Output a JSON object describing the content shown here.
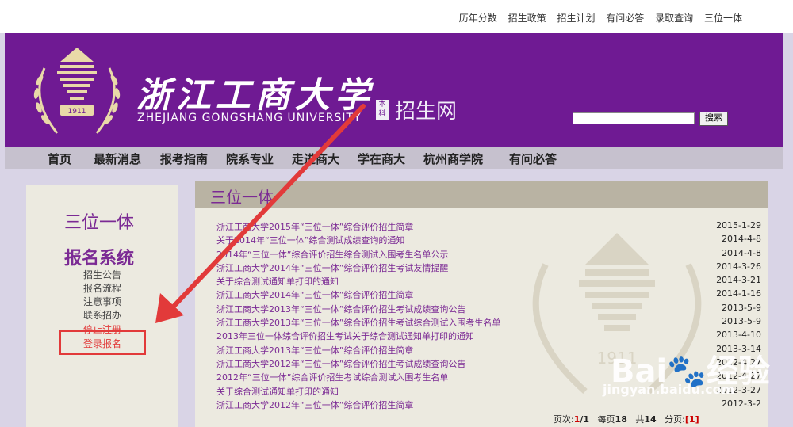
{
  "top_links": [
    "历年分数",
    "招生政策",
    "招生计划",
    "有问必答",
    "录取查询",
    "三位一体"
  ],
  "banner": {
    "emblem_year": "1911",
    "logo_cn": "浙江工商大学",
    "logo_en": "ZHEJIANG GONGSHANG UNIVERSITY",
    "benke": "本科",
    "zsw": "招生网",
    "search_button": "搜索",
    "search_value": ""
  },
  "nav": [
    "首页",
    "最新消息",
    "报考指南",
    "院系专业",
    "走进商大",
    "学在商大",
    "杭州商学院",
    "有问必答"
  ],
  "sidebar": {
    "title1": "三位一体",
    "title2": "报名系统",
    "items": [
      "招生公告",
      "报名流程",
      "注意事项",
      "联系招办",
      "停止注册",
      "登录报名"
    ]
  },
  "content": {
    "title": "三位一体",
    "news": [
      {
        "title": "浙江工商大学2015年“三位一体”综合评价招生简章",
        "date": "2015-1-29"
      },
      {
        "title": "关于2014年“三位一体”综合测试成绩查询的通知",
        "date": "2014-4-8"
      },
      {
        "title": "2014年“三位一体”综合评价招生综合测试入围考生名单公示",
        "date": "2014-4-8"
      },
      {
        "title": "浙江工商大学2014年“三位一体”综合评价招生考试友情提醒",
        "date": "2014-3-26"
      },
      {
        "title": "关于综合测试通知单打印的通知",
        "date": "2014-3-21"
      },
      {
        "title": "浙江工商大学2014年“三位一体”综合评价招生简章",
        "date": "2014-1-16"
      },
      {
        "title": "浙江工商大学2013年“三位一体”综合评价招生考试成绩查询公告",
        "date": "2013-5-9"
      },
      {
        "title": "浙江工商大学2013年“三位一体”综合评价招生考试综合测试入围考生名单",
        "date": "2013-5-9"
      },
      {
        "title": "2013年三位一体综合评价招生考试关于综合测试通知单打印的通知",
        "date": "2013-4-10"
      },
      {
        "title": "浙江工商大学2013年“三位一体”综合评价招生简章",
        "date": "2013-3-14"
      },
      {
        "title": "浙江工商大学2012年“三位一体”综合评价招生考试成绩查询公告",
        "date": "2012-4-27"
      },
      {
        "title": "2012年“三位一体”综合评价招生考试综合测试入围考生名单",
        "date": "2012-4-27"
      },
      {
        "title": "关于综合测试通知单打印的通知",
        "date": "2012-3-27"
      },
      {
        "title": "浙江工商大学2012年“三位一体”综合评价招生简章",
        "date": "2012-3-2"
      }
    ],
    "pager": {
      "page_label": "页次:",
      "page": "1",
      "total_pages": "/1",
      "per_page_label": "每页",
      "per_page": "18",
      "total_label": "共",
      "total": "14",
      "paging_label": "分页:",
      "page_link": "[1]"
    }
  },
  "watermark": {
    "brand": "Bai",
    "brand_end": "经验",
    "url": "jingyan.baidu.com"
  },
  "colors": {
    "purple": "#6f1a93",
    "accent": "#7b2a94",
    "red": "#e23a3a"
  }
}
